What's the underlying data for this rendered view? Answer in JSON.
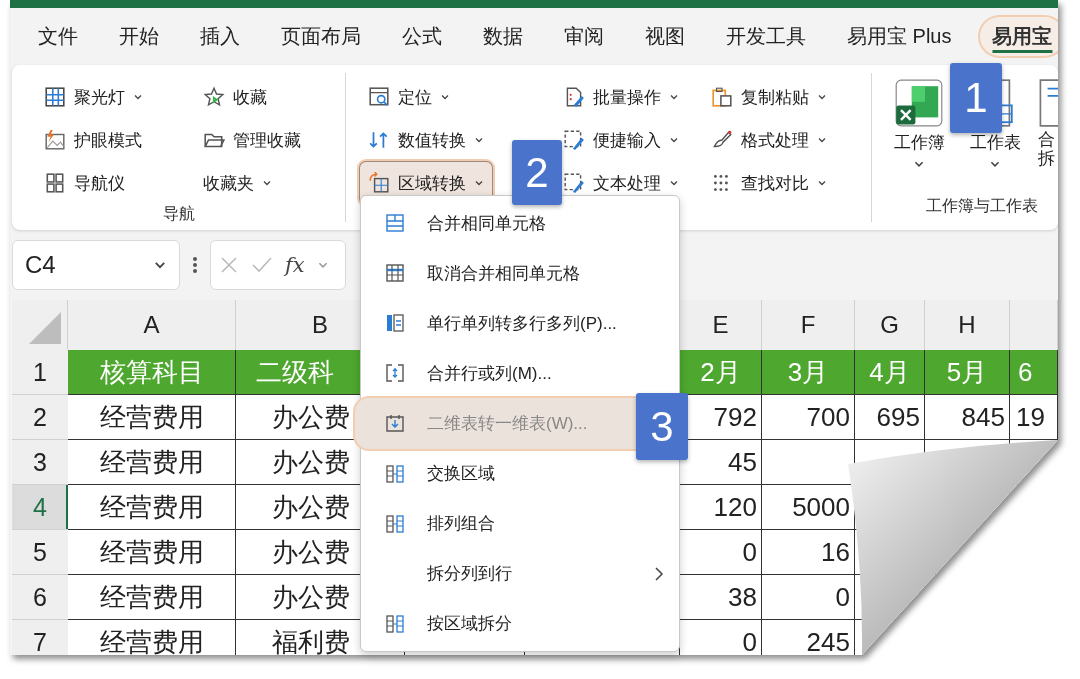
{
  "tabs": [
    {
      "label": "文件",
      "selected": false
    },
    {
      "label": "开始",
      "selected": false
    },
    {
      "label": "插入",
      "selected": false
    },
    {
      "label": "页面布局",
      "selected": false
    },
    {
      "label": "公式",
      "selected": false
    },
    {
      "label": "数据",
      "selected": false
    },
    {
      "label": "审阅",
      "selected": false
    },
    {
      "label": "视图",
      "selected": false
    },
    {
      "label": "开发工具",
      "selected": false
    },
    {
      "label": "易用宝 Plus",
      "selected": false
    },
    {
      "label": "易用宝",
      "selected": true
    }
  ],
  "ribbon": {
    "groups": [
      {
        "kind": "small",
        "label": "导航",
        "columns": [
          [
            {
              "label": "聚光灯",
              "dropdown": true,
              "pressed": false
            },
            {
              "label": "护眼模式",
              "dropdown": false,
              "pressed": false
            },
            {
              "label": "导航仪",
              "dropdown": false,
              "pressed": false
            }
          ],
          [
            {
              "label": "收藏",
              "dropdown": false,
              "pressed": false
            },
            {
              "label": "管理收藏",
              "dropdown": false,
              "pressed": false
            },
            {
              "label": "收藏夹",
              "dropdown": true,
              "pressed": false
            }
          ]
        ]
      },
      {
        "kind": "small",
        "columns": [
          [
            {
              "label": "定位",
              "dropdown": true,
              "pressed": false
            },
            {
              "label": "数值转换",
              "dropdown": true,
              "pressed": false
            },
            {
              "label": "区域转换",
              "dropdown": true,
              "pressed": true
            }
          ],
          [
            {
              "label": "批量操作",
              "dropdown": true,
              "pressed": false
            },
            {
              "label": "便捷输入",
              "dropdown": true,
              "pressed": false
            },
            {
              "label": "文本处理",
              "dropdown": true,
              "pressed": false
            }
          ],
          [
            {
              "label": "复制粘贴",
              "dropdown": true,
              "pressed": false
            },
            {
              "label": "格式处理",
              "dropdown": true,
              "pressed": false
            },
            {
              "label": "查找对比",
              "dropdown": true,
              "pressed": false
            }
          ]
        ]
      },
      {
        "kind": "large",
        "label": "工作簿与工作表",
        "buttons": [
          {
            "label": "工作簿",
            "dropdown": true
          },
          {
            "label": "工作表",
            "dropdown": true
          },
          {
            "label": "合拆",
            "dropdown": false
          }
        ]
      }
    ]
  },
  "formula_bar": {
    "name_box": "C4",
    "function_label": "fx"
  },
  "sheet": {
    "columns": [
      "A",
      "B",
      null,
      null,
      "E",
      "F",
      "G",
      "H",
      null
    ],
    "rows": [
      {
        "number": "1",
        "kind": "header",
        "selected": false,
        "cells": [
          "核算科目",
          "二级科",
          null,
          null,
          "2月",
          "3月",
          "4月",
          "5月",
          "6"
        ]
      },
      {
        "number": "2",
        "kind": "data",
        "selected": false,
        "cells": [
          "经营费用",
          "办公费",
          null,
          null,
          "792",
          "700",
          "695",
          "845",
          "19"
        ]
      },
      {
        "number": "3",
        "kind": "data",
        "selected": false,
        "cells": [
          "经营费用",
          "办公费",
          null,
          null,
          "45",
          null,
          null,
          null,
          null
        ]
      },
      {
        "number": "4",
        "kind": "data",
        "selected": true,
        "cells": [
          "经营费用",
          "办公费",
          null,
          null,
          "120",
          "5000",
          null,
          null,
          null
        ]
      },
      {
        "number": "5",
        "kind": "data",
        "selected": false,
        "cells": [
          "经营费用",
          "办公费",
          null,
          null,
          "0",
          "16",
          null,
          null,
          null
        ]
      },
      {
        "number": "6",
        "kind": "data",
        "selected": false,
        "cells": [
          "经营费用",
          "办公费",
          null,
          null,
          "38",
          "0",
          null,
          null,
          null
        ]
      },
      {
        "number": "7",
        "kind": "data",
        "selected": false,
        "cells": [
          "经营费用",
          "福利费",
          null,
          null,
          "0",
          "245",
          null,
          null,
          null
        ]
      }
    ]
  },
  "menu": {
    "items": [
      {
        "label": "合并相同单元格",
        "kind": "command",
        "selected": false
      },
      {
        "label": "取消合并相同单元格",
        "kind": "command",
        "selected": false
      },
      {
        "label": "单行单列转多行多列(P)...",
        "kind": "command",
        "selected": false
      },
      {
        "label": "合并行或列(M)...",
        "kind": "command",
        "selected": false
      },
      {
        "label": "二维表转一维表(W)...",
        "kind": "command",
        "selected": true
      },
      {
        "label": "交换区域",
        "kind": "command",
        "selected": false
      },
      {
        "label": "排列组合",
        "kind": "command",
        "selected": false
      },
      {
        "label": "拆分列到行",
        "kind": "submenu",
        "selected": false
      },
      {
        "label": "按区域拆分",
        "kind": "command",
        "selected": false
      }
    ]
  },
  "badges": [
    {
      "text": "1"
    },
    {
      "text": "2"
    },
    {
      "text": "3"
    }
  ]
}
